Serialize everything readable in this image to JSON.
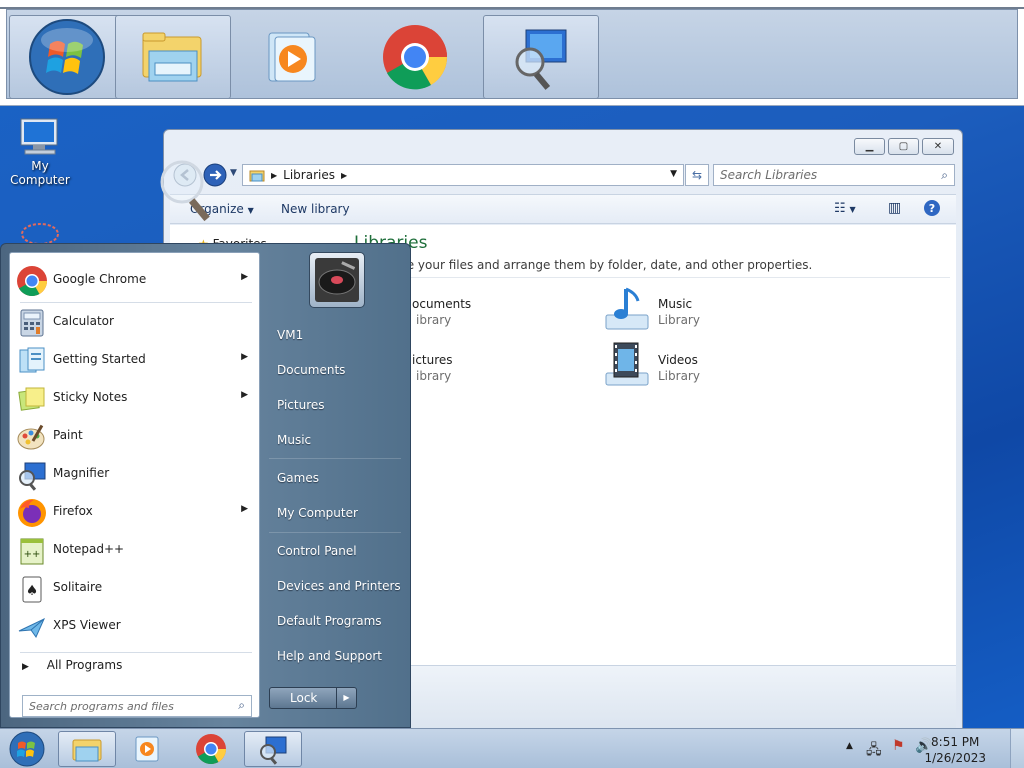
{
  "desktop": {
    "icons": [
      {
        "label": "My Computer",
        "icon": "computer-icon"
      },
      {
        "label": "",
        "icon": "recycle-bin-icon"
      }
    ]
  },
  "magnifier": {
    "tiles": [
      "start-orb-icon",
      "file-explorer-icon",
      "media-player-icon",
      "chrome-icon",
      "magnifier-icon"
    ]
  },
  "explorer": {
    "breadcrumb": "Libraries",
    "search_placeholder": "Search Libraries",
    "toolbar": {
      "organize": "Organize",
      "new_library": "New library"
    },
    "nav_favorites": "Favorites",
    "title": "Libraries",
    "subtitle": "Open a library to see your files and arrange them by folder, date, and other properties.",
    "subtitle_visible": "ary to see your files and arrange them by folder, date, and other properties.",
    "libraries": [
      {
        "name": "Documents",
        "visible_name": "ocuments",
        "type": "Library",
        "visible_type": "ibrary",
        "icon": "documents-library-icon"
      },
      {
        "name": "Music",
        "visible_name": "Music",
        "type": "Library",
        "visible_type": "Library",
        "icon": "music-library-icon"
      },
      {
        "name": "Pictures",
        "visible_name": "ictures",
        "type": "Library",
        "visible_type": "ibrary",
        "icon": "pictures-library-icon"
      },
      {
        "name": "Videos",
        "visible_name": "Videos",
        "type": "Library",
        "visible_type": "Library",
        "icon": "videos-library-icon"
      }
    ]
  },
  "start_menu": {
    "programs": [
      {
        "label": "Google Chrome",
        "icon": "chrome-icon",
        "submenu": true
      },
      {
        "label": "Calculator",
        "icon": "calculator-icon",
        "submenu": false
      },
      {
        "label": "Getting Started",
        "icon": "getting-started-icon",
        "submenu": true
      },
      {
        "label": "Sticky Notes",
        "icon": "sticky-notes-icon",
        "submenu": true
      },
      {
        "label": "Paint",
        "icon": "paint-icon",
        "submenu": false
      },
      {
        "label": "Magnifier",
        "icon": "magnifier-icon",
        "submenu": false
      },
      {
        "label": "Firefox",
        "icon": "firefox-icon",
        "submenu": true
      },
      {
        "label": "Notepad++",
        "icon": "notepadpp-icon",
        "submenu": false
      },
      {
        "label": "Solitaire",
        "icon": "solitaire-icon",
        "submenu": false
      },
      {
        "label": "XPS Viewer",
        "icon": "xps-viewer-icon",
        "submenu": false
      }
    ],
    "all_programs": "All Programs",
    "search_placeholder": "Search programs and files",
    "right_items": [
      "VM1",
      "Documents",
      "Pictures",
      "Music",
      "Games",
      "My Computer",
      "Control Panel",
      "Devices and Printers",
      "Default Programs",
      "Help and Support"
    ],
    "lock_label": "Lock"
  },
  "taskbar": {
    "buttons": [
      "start-orb-icon",
      "file-explorer-icon",
      "media-player-icon",
      "chrome-icon",
      "magnifier-icon"
    ],
    "time": "8:51 PM",
    "date": "1/26/2023"
  }
}
